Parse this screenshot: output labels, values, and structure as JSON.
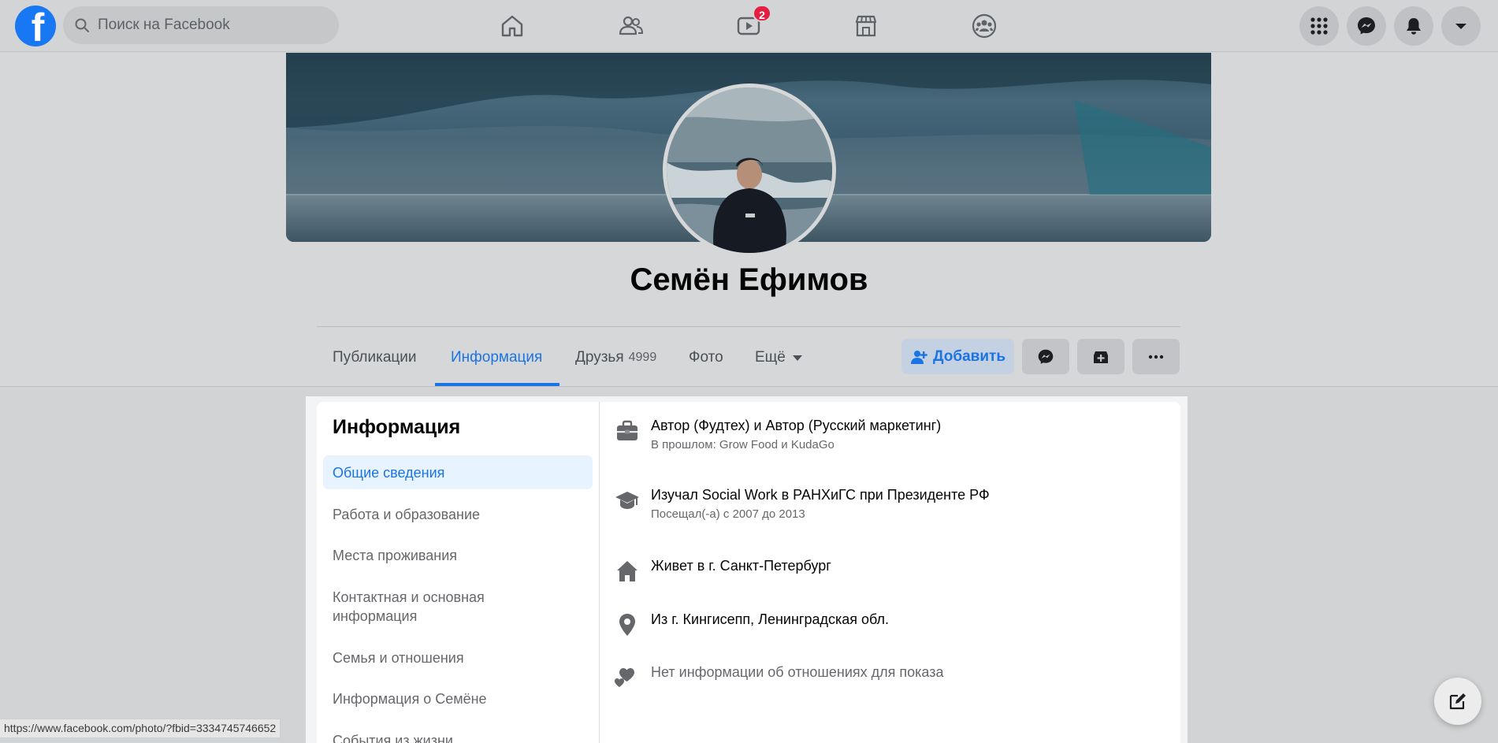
{
  "app": {
    "brand_letter": "f",
    "accent_color": "#1b74e4",
    "search": {
      "placeholder": "Поиск на Facebook",
      "value": ""
    },
    "nav": {
      "items": [
        {
          "name": "home",
          "icon": "home-icon"
        },
        {
          "name": "friends",
          "icon": "friends-icon"
        },
        {
          "name": "watch",
          "icon": "video-icon",
          "badge": "2"
        },
        {
          "name": "marketplace",
          "icon": "store-icon"
        },
        {
          "name": "groups",
          "icon": "groups-icon"
        }
      ],
      "right_buttons": [
        "menu-grid-icon",
        "messenger-icon",
        "notifications-bell-icon",
        "account-caret-icon"
      ]
    }
  },
  "profile": {
    "name": "Семён Ефимов",
    "tabs": [
      {
        "label": "Публикации"
      },
      {
        "label": "Информация",
        "active": true
      },
      {
        "label": "Друзья",
        "count": "4999"
      },
      {
        "label": "Фото"
      },
      {
        "label": "Ещё"
      }
    ],
    "actions": {
      "add_label": "Добавить"
    }
  },
  "about": {
    "title": "Информация",
    "sidebar": [
      {
        "label": "Общие сведения",
        "active": true
      },
      {
        "label": "Работа и образование"
      },
      {
        "label": "Места проживания"
      },
      {
        "label": "Контактная и основная информация"
      },
      {
        "label": "Семья и отношения"
      },
      {
        "label": "Информация о Семёне"
      },
      {
        "label": "События из жизни"
      }
    ],
    "items": [
      {
        "icon": "briefcase-icon",
        "main": "Автор (Фудтех) и Автор (Русский маркетинг)",
        "sub": "В прошлом: Grow Food и KudaGo"
      },
      {
        "icon": "graduation-cap-icon",
        "main": "Изучал Social Work в РАНХиГС при Президенте РФ",
        "sub": "Посещал(-а) с 2007 до 2013"
      },
      {
        "icon": "house-icon",
        "main": "Живет в г. Санкт-Петербург"
      },
      {
        "icon": "location-pin-icon",
        "main": "Из г. Кингисепп, Ленинградская обл."
      },
      {
        "icon": "hearts-icon",
        "main": "Нет информации об отношениях для показа"
      }
    ]
  },
  "status_bar": {
    "url": "https://www.facebook.com/photo/?fbid=3334745746652"
  }
}
